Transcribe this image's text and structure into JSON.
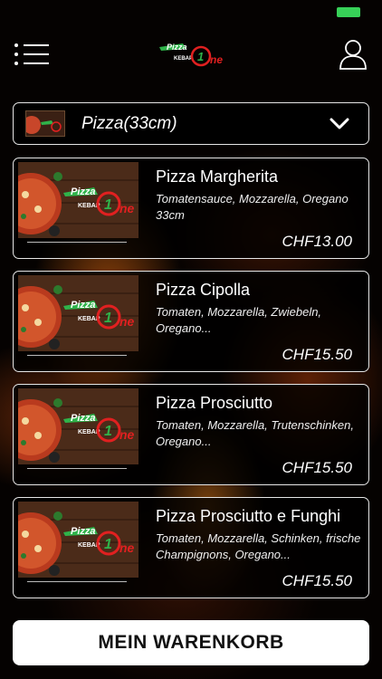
{
  "status": {
    "battery_color": "#37d158"
  },
  "header": {
    "menu_icon": "hamburger-list-icon",
    "logo": {
      "line1": "Pizza",
      "line2": "KEBAP",
      "digit": "1",
      "word": "ne"
    },
    "user_icon": "user-profile-icon"
  },
  "category": {
    "selected": "Pizza(33cm)",
    "chevron_icon": "chevron-down-icon"
  },
  "products": [
    {
      "name": "Pizza Margherita",
      "description": "Tomatensauce, Mozzarella, Oregano 33cm",
      "price": "CHF13.00"
    },
    {
      "name": "Pizza Cipolla",
      "description": "Tomaten, Mozzarella, Zwiebeln, Oregano...",
      "price": "CHF15.50"
    },
    {
      "name": "Pizza Prosciutto",
      "description": "Tomaten, Mozzarella, Trutenschinken, Oregano...",
      "price": "CHF15.50"
    },
    {
      "name": "Pizza Prosciutto e Funghi",
      "description": "Tomaten, Mozzarella, Schinken, frische Champignons, Oregano...",
      "price": "CHF15.50"
    }
  ],
  "cart": {
    "label": "MEIN WARENKORB"
  },
  "colors": {
    "accent_green": "#2fb34a",
    "accent_red": "#e02020",
    "background": "#000000"
  }
}
